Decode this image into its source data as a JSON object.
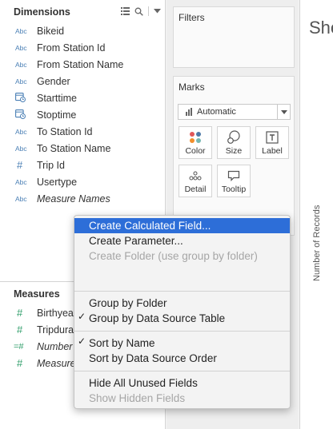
{
  "data_pane": {
    "dimensions_header": "Dimensions",
    "dimensions": [
      {
        "icon": "Abc",
        "label": "Bikeid",
        "italic": false
      },
      {
        "icon": "Abc",
        "label": "From Station Id",
        "italic": false
      },
      {
        "icon": "Abc",
        "label": "From Station Name",
        "italic": false
      },
      {
        "icon": "Abc",
        "label": "Gender",
        "italic": false
      },
      {
        "icon": "date",
        "label": "Starttime",
        "italic": false
      },
      {
        "icon": "date",
        "label": "Stoptime",
        "italic": false
      },
      {
        "icon": "Abc",
        "label": "To Station Id",
        "italic": false
      },
      {
        "icon": "Abc",
        "label": "To Station Name",
        "italic": false
      },
      {
        "icon": "#",
        "label": "Trip Id",
        "italic": false
      },
      {
        "icon": "Abc",
        "label": "Usertype",
        "italic": false
      },
      {
        "icon": "Abc",
        "label": "Measure Names",
        "italic": true
      }
    ],
    "measures_header": "Measures",
    "measures": [
      {
        "icon": "#",
        "label": "Birthyear",
        "italic": false
      },
      {
        "icon": "#",
        "label": "Tripduration",
        "italic": false
      },
      {
        "icon": "=#",
        "label": "Number of Records",
        "italic": true
      },
      {
        "icon": "#",
        "label": "Measure Values",
        "italic": true
      }
    ]
  },
  "cards": {
    "filters_title": "Filters",
    "marks_title": "Marks",
    "mark_type": "Automatic",
    "mark_buttons": {
      "color": "Color",
      "size": "Size",
      "label": "Label",
      "detail": "Detail",
      "tooltip": "Tooltip"
    }
  },
  "view": {
    "sheet_title": "She",
    "axis_label": "Number of Records"
  },
  "context_menu": {
    "create_calculated_field": "Create Calculated Field...",
    "create_parameter": "Create Parameter...",
    "create_folder": "Create Folder (use group by folder)",
    "group_by_folder": "Group by Folder",
    "group_by_data_source_table": "Group by Data Source Table",
    "sort_by_name": "Sort by Name",
    "sort_by_data_source_order": "Sort by Data Source Order",
    "hide_all_unused_fields": "Hide All Unused Fields",
    "show_hidden_fields": "Show Hidden Fields",
    "check_mark": "✓"
  },
  "colors": {
    "highlight": "#2d6ed8",
    "dimension_icon": "#4a7fb5",
    "measure_icon": "#2f9e6a"
  }
}
